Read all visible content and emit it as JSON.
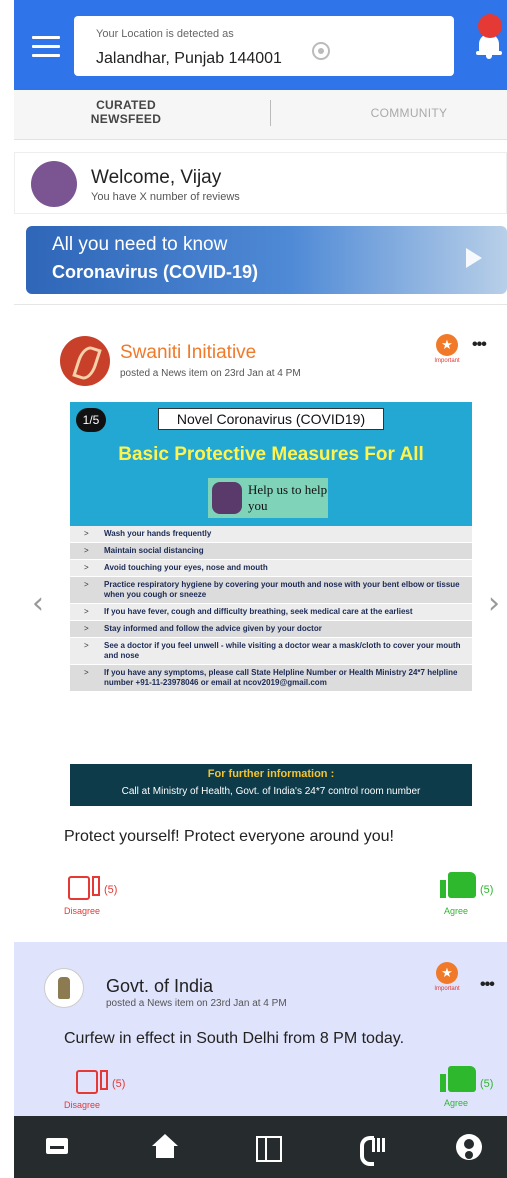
{
  "header": {
    "location_label": "Your Location is detected as",
    "location_value": "Jalandhar, Punjab 144001"
  },
  "tabs": [
    {
      "label_line1": "CURATED",
      "label_line2": "NEWSFEED"
    },
    {
      "label": "COMMUNITY"
    }
  ],
  "welcome": {
    "title": "Welcome, Vijay",
    "subtitle": "You have X number of reviews"
  },
  "banner": {
    "line1": "All you need to know",
    "line2": "Coronavirus (COVID-19)"
  },
  "posts": [
    {
      "author": "Swaniti Initiative",
      "meta": "posted a News item on 23rd Jan at 4 PM",
      "badge_label": "Important",
      "more": "•••",
      "slide_indicator": "1/5",
      "infographic": {
        "title": "Novel Coronavirus (COVID19)",
        "headline": "Basic Protective Measures For All",
        "help_text": "Help us to help you",
        "items": [
          "Wash your hands frequently",
          "Maintain social distancing",
          "Avoid touching your eyes, nose and mouth",
          "Practice respiratory hygiene by covering your mouth and nose with your bent elbow or tissue when you cough or sneeze",
          "If you have fever, cough and difficulty breathing, seek medical care at the earliest",
          "Stay informed and follow the advice given by your doctor",
          "See a doctor if you feel unwell - while visiting a doctor wear a mask/cloth to cover your mouth and nose",
          "If you have any symptoms, please call State Helpline Number or Health Ministry 24*7 helpline number +91-11-23978046 or email at ncov2019@gmail.com"
        ],
        "footer_title": "For further information :",
        "footer_text": "Call at Ministry of Health, Govt. of India's  24*7 control room number"
      },
      "caption": "Protect yourself! Protect everyone around you!",
      "disagree": {
        "count": "(5)",
        "label": "Disagree"
      },
      "agree": {
        "count": "(5)",
        "label": "Agree"
      }
    },
    {
      "author": "Govt. of India",
      "meta": "posted a News item on 23rd Jan at 4 PM",
      "badge_label": "Important",
      "more": "•••",
      "text": "Curfew in effect in South Delhi from 8 PM today.",
      "disagree": {
        "count": "(5)",
        "label": "Disagree"
      },
      "agree": {
        "count": "(5)",
        "label": "Agree"
      }
    }
  ],
  "icons": {
    "menu": "menu-icon",
    "location": "target-icon",
    "notifications": "bell-icon",
    "nav": [
      "card-icon",
      "home-icon",
      "map-icon",
      "phone-icon",
      "user-icon"
    ]
  },
  "colors": {
    "primary": "#2f74e8",
    "accent_orange": "#f07a2a",
    "agree_green": "#2eb82e",
    "disagree_red": "#e53935",
    "nav_bg": "#262c2e"
  }
}
